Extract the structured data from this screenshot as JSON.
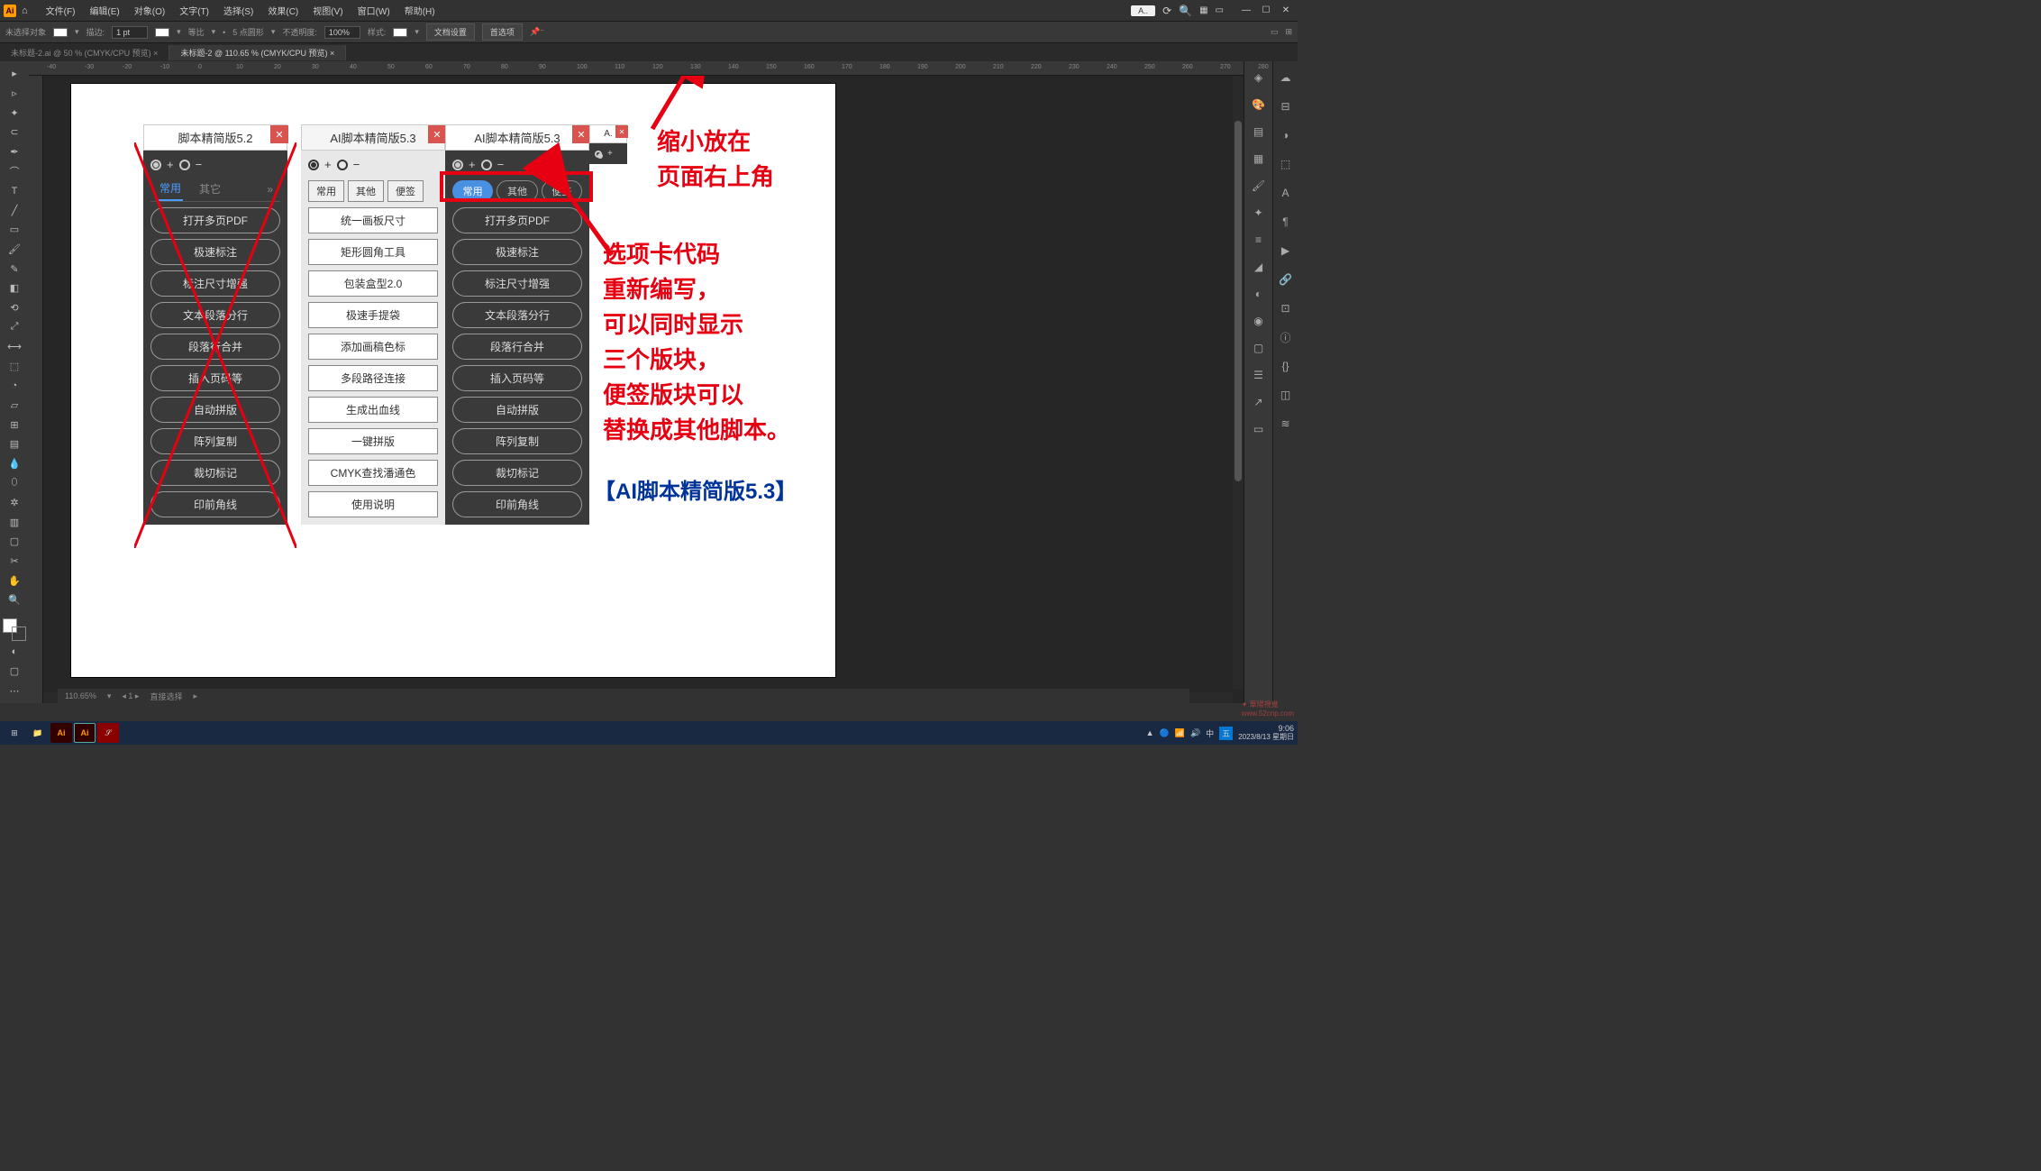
{
  "menubar": {
    "logo": "Ai",
    "items": [
      "文件(F)",
      "编辑(E)",
      "对象(O)",
      "文字(T)",
      "选择(S)",
      "效果(C)",
      "视图(V)",
      "窗口(W)",
      "帮助(H)"
    ],
    "minimized_label": "A..",
    "search_icon": "search"
  },
  "optionbar": {
    "no_selection": "未选择对象",
    "stroke_label": "描边:",
    "stroke_val": "1 pt",
    "uniform": "等比",
    "pt_round": "5 点圆形",
    "opacity_label": "不透明度:",
    "opacity_val": "100%",
    "style_label": "样式:",
    "doc_setup": "文档设置",
    "prefs": "首选项"
  },
  "tabs": {
    "t1": "未标题-2.ai @ 50 % (CMYK/CPU 预览)",
    "t2": "未标题-2 @ 110.65 % (CMYK/CPU 预览)"
  },
  "panel52": {
    "title": "脚本精简版5.2",
    "tabs": {
      "common": "常用",
      "other": "其它"
    },
    "buttons": [
      "打开多页PDF",
      "极速标注",
      "标注尺寸增强",
      "文本段落分行",
      "段落行合并",
      "插入页码等",
      "自动拼版",
      "阵列复制",
      "裁切标记",
      "印前角线"
    ]
  },
  "panel53l": {
    "title": "AI脚本精简版5.3",
    "tabs": {
      "common": "常用",
      "other": "其他",
      "notes": "便签"
    },
    "buttons": [
      "统一画板尺寸",
      "矩形圆角工具",
      "包装盒型2.0",
      "极速手提袋",
      "添加画稿色标",
      "多段路径连接",
      "生成出血线",
      "一键拼版",
      "CMYK查找潘通色",
      "使用说明"
    ]
  },
  "panel53d": {
    "title": "AI脚本精简版5.3",
    "tabs": {
      "common": "常用",
      "other": "其他",
      "notes": "便签"
    },
    "buttons": [
      "打开多页PDF",
      "极速标注",
      "标注尺寸增强",
      "文本段落分行",
      "段落行合并",
      "插入页码等",
      "自动拼版",
      "阵列复制",
      "裁切标记",
      "印前角线"
    ]
  },
  "panelmin": {
    "title": "A."
  },
  "annotations": {
    "top": "缩小放在\n页面右上角",
    "mid": "选项卡代码\n重新编写，\n可以同时显示\n三个版块，\n便签版块可以\n替换成其他脚本。",
    "bottom": "【AI脚本精简版5.3】"
  },
  "status": {
    "zoom": "110.65%",
    "tool": "直接选择"
  },
  "taskbar": {
    "time": "9:06",
    "date": "2023/8/13 星期日"
  },
  "ruler_marks": [
    "-40",
    "-30",
    "-20",
    "-10",
    "0",
    "10",
    "20",
    "30",
    "40",
    "50",
    "60",
    "70",
    "80",
    "90",
    "100",
    "110",
    "120",
    "130",
    "140",
    "150",
    "160",
    "170",
    "180",
    "190",
    "200",
    "210",
    "220",
    "230",
    "240",
    "250",
    "260",
    "270",
    "280"
  ]
}
